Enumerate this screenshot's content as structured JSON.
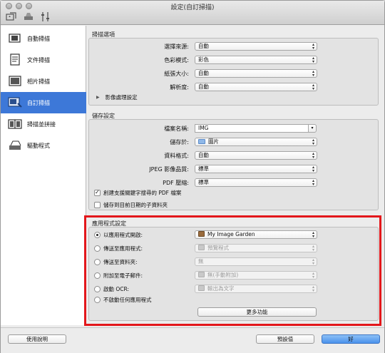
{
  "window": {
    "title": "設定(自訂掃描)"
  },
  "toolbar": {
    "icons": [
      "scan-settings-icon",
      "scanner-icon",
      "preferences-icon"
    ]
  },
  "sidebar": {
    "items": [
      {
        "label": "自動掃描",
        "icon": "auto-scan-icon"
      },
      {
        "label": "文件掃描",
        "icon": "document-scan-icon"
      },
      {
        "label": "相片掃描",
        "icon": "photo-scan-icon"
      },
      {
        "label": "自訂掃描",
        "icon": "custom-scan-icon",
        "active": true
      },
      {
        "label": "掃描並拼接",
        "icon": "scan-stitch-icon"
      },
      {
        "label": "驅動程式",
        "icon": "driver-icon"
      }
    ]
  },
  "scan_options": {
    "title": "掃描選項",
    "source_label": "選擇來源:",
    "source_value": "自動",
    "color_label": "色彩模式:",
    "color_value": "彩色",
    "paper_label": "紙張大小:",
    "paper_value": "自動",
    "resolution_label": "解析度:",
    "resolution_value": "自動",
    "image_processing_label": "影像處理設定"
  },
  "save_settings": {
    "title": "儲存設定",
    "filename_label": "檔案名稱:",
    "filename_value": "IMG",
    "save_in_label": "儲存於:",
    "save_in_value": "圖片",
    "format_label": "資料格式:",
    "format_value": "自動",
    "jpeg_label": "JPEG 影像品質:",
    "jpeg_value": "標準",
    "pdf_label": "PDF 壓縮:",
    "pdf_value": "標準",
    "keyword_pdf_label": "創建支援關鍵字搜尋的 PDF 檔案",
    "keyword_pdf_checked": true,
    "date_subfolder_label": "儲存到目前日期的子資料夾",
    "date_subfolder_checked": false
  },
  "app_settings": {
    "title": "應用程式設定",
    "open_app_label": "以應用程式開啟:",
    "open_app_value": "My Image Garden",
    "send_app_label": "傳送至應用程式:",
    "send_app_value": "預覽程式",
    "send_folder_label": "傳送至資料夾:",
    "send_folder_value": "無",
    "email_label": "附加至電子郵件:",
    "email_value": "無(手動附加)",
    "ocr_label": "啟動 OCR:",
    "ocr_value": "輸出為文字",
    "no_app_label": "不啟動任何應用程式",
    "more_functions_label": "更多功能"
  },
  "footer": {
    "help_label": "使用說明",
    "defaults_label": "預設值",
    "ok_label": "好"
  },
  "colors": {
    "accent": "#3d78d8",
    "highlight_border": "#e3171b"
  }
}
